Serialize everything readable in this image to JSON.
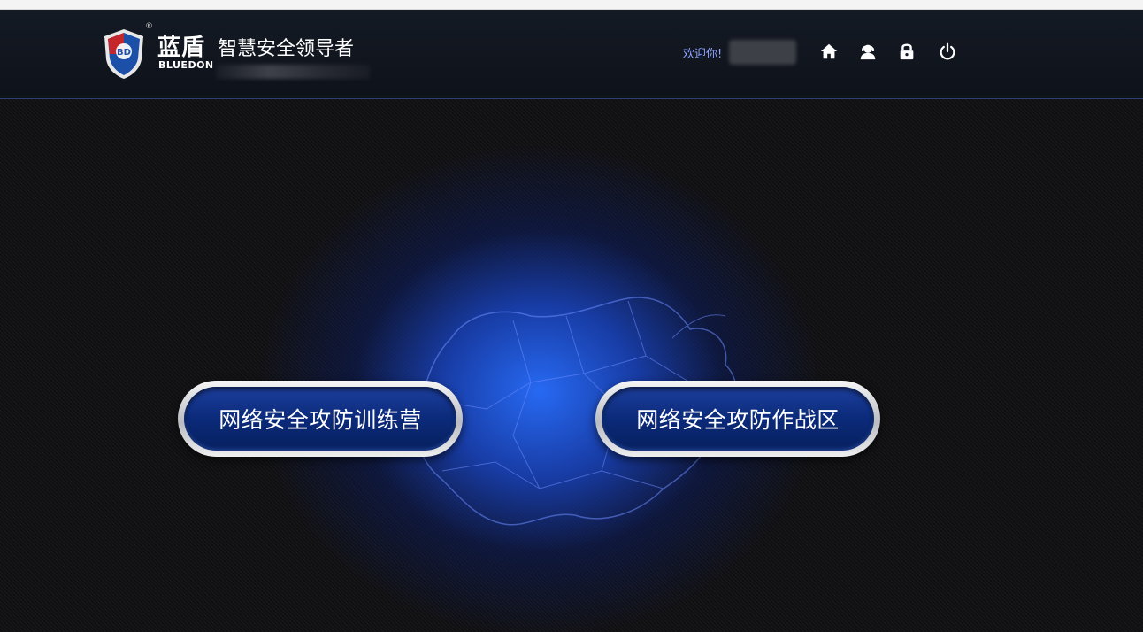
{
  "header": {
    "brand_cn": "蓝盾",
    "brand_en": "BLUEDON",
    "registered_mark": "®",
    "slogan": "智慧安全领导者",
    "shield_text": "BD",
    "welcome_text": "欢迎你!",
    "icons": [
      "home-icon",
      "user-support-icon",
      "lock-icon",
      "power-icon"
    ]
  },
  "main": {
    "buttons": [
      {
        "label": "网络安全攻防训练营"
      },
      {
        "label": "网络安全攻防作战区"
      }
    ]
  },
  "colors": {
    "header_bg": "#121821",
    "accent_blue": "#1f5fff",
    "button_blue": "#0b2a7a",
    "welcome_text": "#8fa4ff"
  }
}
